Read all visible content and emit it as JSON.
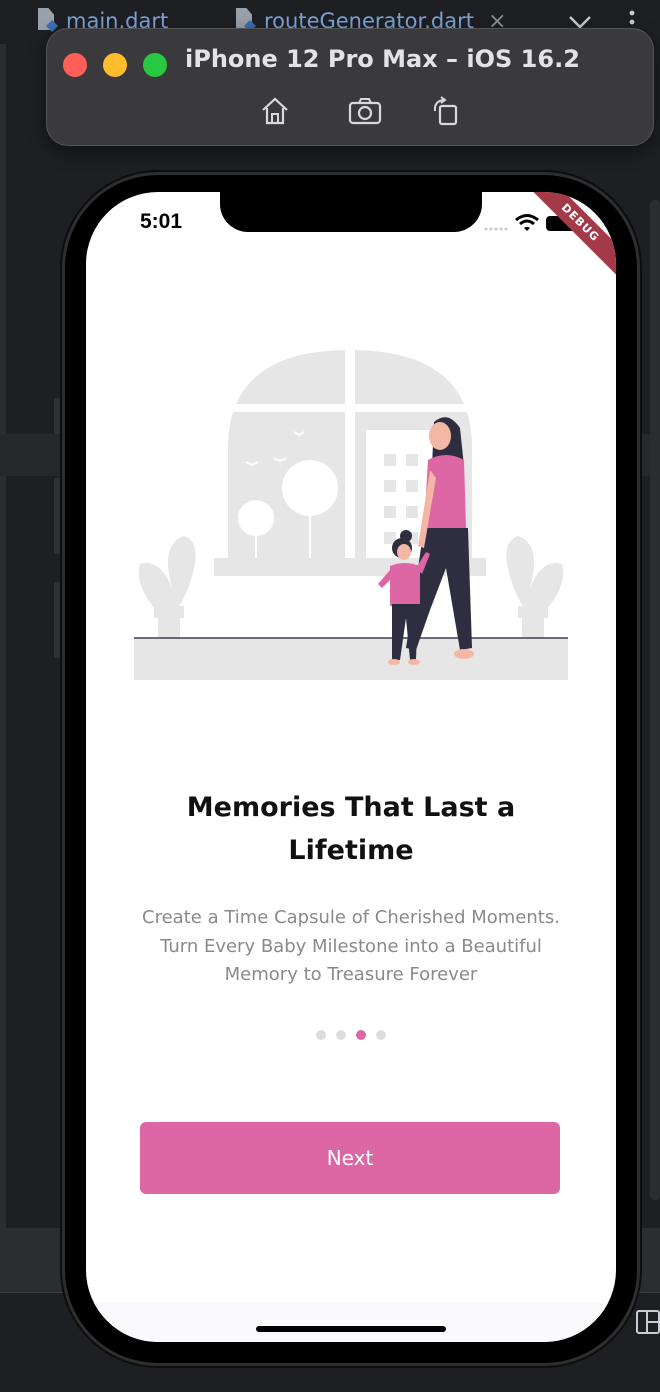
{
  "ide": {
    "tabs": [
      {
        "label": "main.dart"
      },
      {
        "label": "routeGenerator.dart",
        "close": "×"
      }
    ]
  },
  "simulator": {
    "title": "iPhone 12 Pro Max – iOS 16.2",
    "buttons": [
      "home-icon",
      "screenshot-icon",
      "rotate-icon"
    ]
  },
  "status_bar": {
    "time": "5:01",
    "debug_banner": "DEBUG"
  },
  "onboarding": {
    "title": "Memories That Last a Lifetime",
    "description": "Create a Time Capsule of Cherished Moments. Turn Every Baby Milestone into a Beautiful Memory to Treasure Forever",
    "page_count": 4,
    "active_page": 3,
    "next_label": "Next"
  },
  "colors": {
    "accent": "#dd67a5",
    "illustration_gray": "#e6e6e6",
    "dark_figure": "#2f2e41",
    "traffic_close": "#ff5f57",
    "traffic_minimize": "#febc2e",
    "traffic_maximize": "#28c840"
  }
}
